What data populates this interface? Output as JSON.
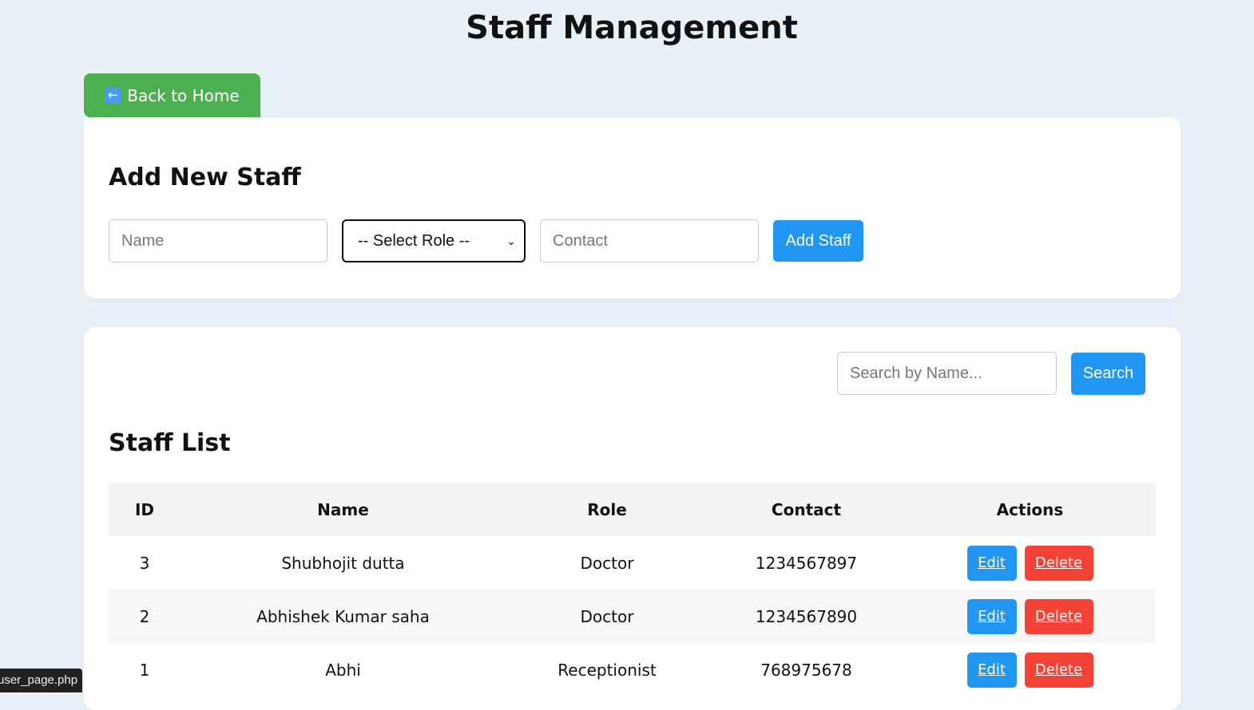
{
  "page": {
    "title": "Staff Management"
  },
  "navigation": {
    "back_icon": "←",
    "back_label": "Back to Home"
  },
  "add_staff": {
    "heading": "Add New Staff",
    "name_placeholder": "Name",
    "name_value": "",
    "role_selected": "-- Select Role --",
    "contact_placeholder": "Contact",
    "contact_value": "",
    "submit_label": "Add Staff"
  },
  "search": {
    "placeholder": "Search by Name...",
    "value": "",
    "button_label": "Search"
  },
  "staff_list": {
    "heading": "Staff List",
    "columns": [
      "ID",
      "Name",
      "Role",
      "Contact",
      "Actions"
    ],
    "rows": [
      {
        "id": "3",
        "name": "Shubhojit dutta",
        "role": "Doctor",
        "contact": "1234567897",
        "edit_label": "Edit",
        "delete_label": "Delete"
      },
      {
        "id": "2",
        "name": "Abhishek Kumar saha",
        "role": "Doctor",
        "contact": "1234567890",
        "edit_label": "Edit",
        "delete_label": "Delete"
      },
      {
        "id": "1",
        "name": "Abhi",
        "role": "Receptionist",
        "contact": "768975678",
        "edit_label": "Edit",
        "delete_label": "Delete"
      }
    ]
  },
  "status": {
    "url": "user_page.php"
  },
  "colors": {
    "background": "#e8f0f8",
    "back_button": "#4caf50",
    "primary": "#2196f3",
    "danger": "#f44336",
    "card": "#ffffff"
  },
  "icons": {
    "back": "left-arrow-icon",
    "select": "chevron-down-icon"
  }
}
